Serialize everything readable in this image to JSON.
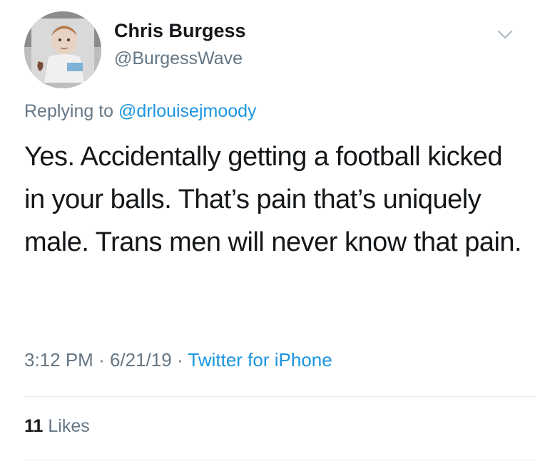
{
  "tweet": {
    "author": {
      "name": "Chris Burgess",
      "handle": "@BurgessWave"
    },
    "reply": {
      "prefix": "Replying to",
      "target": "@drlouisejmoody"
    },
    "text": "Yes. Accidentally getting a football kicked in your balls. That’s pain that’s uniquely male. Trans men will never know that pain.",
    "meta": {
      "time": "3:12 PM",
      "separator": "·",
      "date": "6/21/19",
      "source": "Twitter for iPhone"
    },
    "stats": {
      "likes_count": "11",
      "likes_label": "Likes"
    }
  },
  "icons": {
    "menu": "chevron-down-icon"
  },
  "colors": {
    "text_primary": "#14171a",
    "text_secondary": "#657786",
    "link": "#1b95e0",
    "divider": "#e1e8ed"
  }
}
